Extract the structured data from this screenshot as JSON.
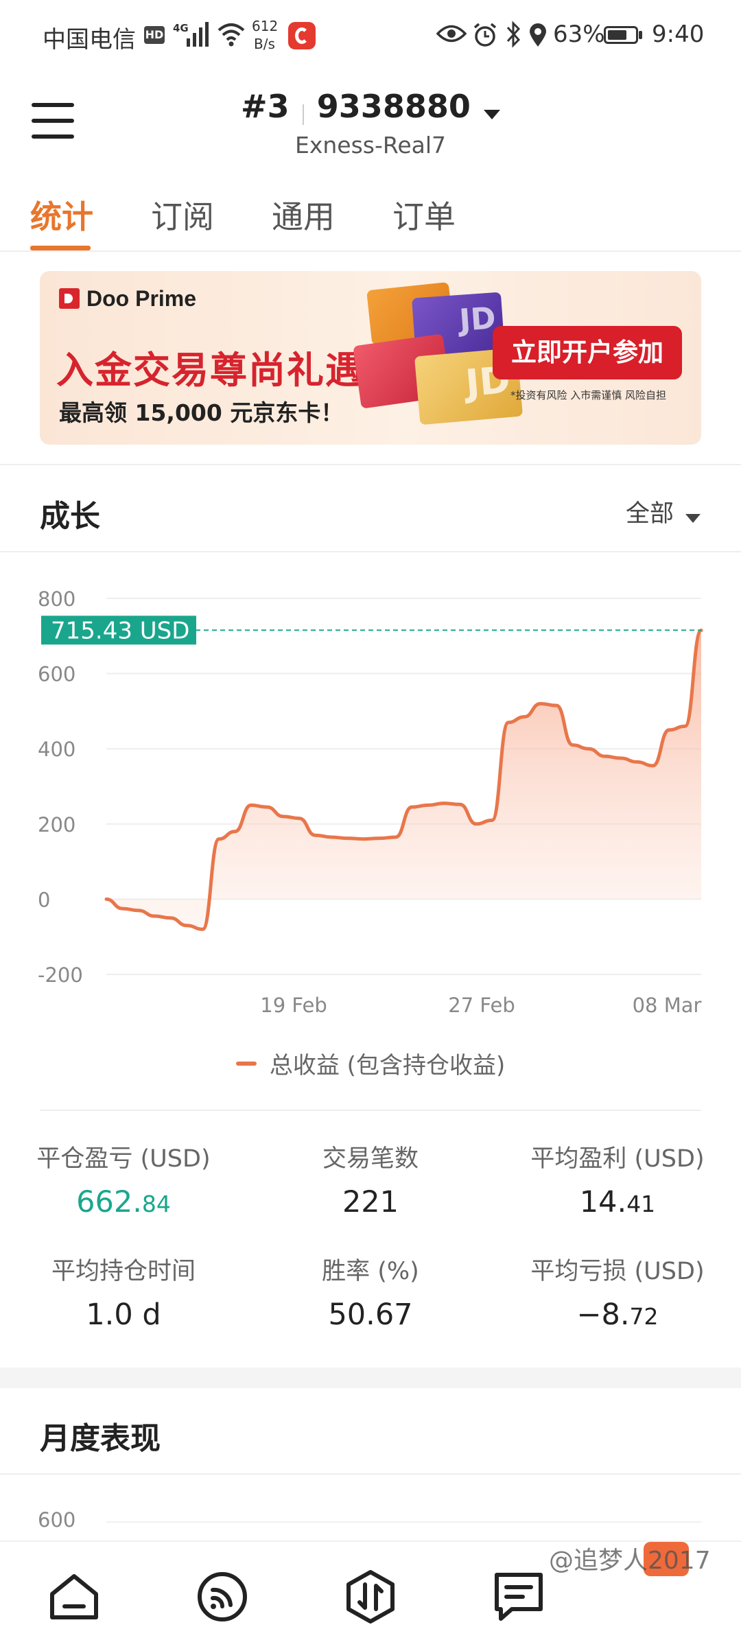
{
  "status_bar": {
    "carrier": "中国电信",
    "hd": "HD",
    "network": "4G",
    "speed_value": "612",
    "speed_unit": "B/s",
    "battery": "63%",
    "time": "9:40"
  },
  "header": {
    "account_prefix": "#3",
    "account_number": "9338880",
    "server": "Exness-Real7"
  },
  "tabs": [
    {
      "label": "统计"
    },
    {
      "label": "订阅"
    },
    {
      "label": "通用"
    },
    {
      "label": "订单"
    }
  ],
  "banner": {
    "brand": "Doo Prime",
    "headline": "入金交易尊尚礼遇",
    "subline": "最高领 15,000 元京东卡！",
    "cta": "立即开户参加",
    "disclaimer": "*投资有风险 入市需谨慎 风险自担",
    "card_text": "JD"
  },
  "growth": {
    "title": "成长",
    "filter": "全部"
  },
  "chart_data": {
    "type": "area",
    "y_ticks": [
      "800",
      "600",
      "400",
      "200",
      "0",
      "-200"
    ],
    "ylim": [
      -200,
      800
    ],
    "x_ticks": [
      "19 Feb",
      "27 Feb",
      "08 Mar"
    ],
    "current_label": "715.43 USD",
    "current_value": 715.43,
    "legend": "总收益 (包含持仓收益)",
    "series": [
      {
        "values": [
          0,
          -25,
          -30,
          -45,
          -50,
          -70,
          -80,
          160,
          180,
          250,
          245,
          220,
          215,
          170,
          165,
          162,
          160,
          162,
          165,
          245,
          250,
          255,
          252,
          200,
          210,
          470,
          485,
          520,
          515,
          410,
          400,
          380,
          375,
          365,
          355,
          450,
          460,
          715
        ]
      }
    ]
  },
  "stats": [
    {
      "label": "平仓盈亏 (USD)",
      "main": "662.",
      "dec": "84",
      "color": "#1aa68c"
    },
    {
      "label": "交易笔数",
      "main": "221",
      "dec": "",
      "color": "#222222"
    },
    {
      "label": "平均盈利 (USD)",
      "main": "14.",
      "dec": "41",
      "color": "#222222"
    },
    {
      "label": "平均持仓时间",
      "main": "1.0 d",
      "dec": "",
      "color": "#222222"
    },
    {
      "label": "胜率 (%)",
      "main": "50.67",
      "dec": "",
      "color": "#222222"
    },
    {
      "label": "平均亏损 (USD)",
      "main": "−8.",
      "dec": "72",
      "color": "#222222"
    }
  ],
  "monthly": {
    "title": "月度表现",
    "y_tick": "600"
  },
  "watermark": "@追梦人2017",
  "colors": {
    "accent": "#e8762c",
    "teal": "#1aa68c",
    "line": "#e8764a"
  },
  "nav_icons": [
    "home-icon",
    "signals-icon",
    "trade-icon",
    "messages-icon",
    "profile-icon"
  ]
}
